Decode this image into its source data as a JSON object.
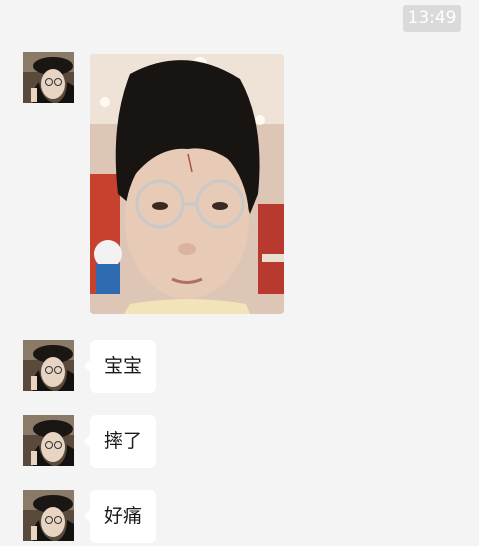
{
  "header": {
    "time": "13:49"
  },
  "messages": [
    {
      "type": "image",
      "sender": "contact",
      "description_icon": "selfie-photo"
    },
    {
      "type": "text",
      "sender": "contact",
      "text": "宝宝"
    },
    {
      "type": "text",
      "sender": "contact",
      "text": "摔了"
    },
    {
      "type": "text",
      "sender": "contact",
      "text": "好痛"
    }
  ],
  "colors": {
    "background": "#f4f4f4",
    "bubble": "#ffffff",
    "time_badge": "#dadada",
    "text": "#1a1a1a"
  }
}
